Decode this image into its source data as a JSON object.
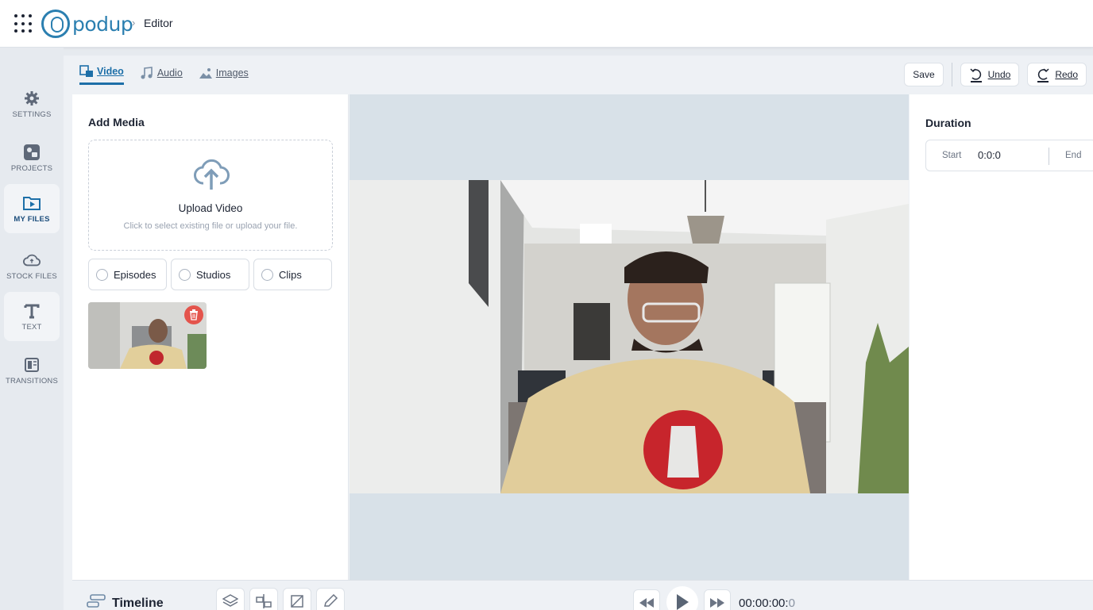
{
  "header": {
    "logo_text": "podup",
    "breadcrumb": "Editor"
  },
  "sidebar": {
    "items": [
      {
        "label": "SETTINGS",
        "icon": "gear-icon"
      },
      {
        "label": "PROJECTS",
        "icon": "projects-icon"
      },
      {
        "label": "MY FILES",
        "icon": "my-files-icon",
        "active": true
      },
      {
        "label": "STOCK FILES",
        "icon": "cloud-icon"
      },
      {
        "label": "TEXT",
        "icon": "text-icon"
      },
      {
        "label": "TRANSITIONS",
        "icon": "transitions-icon"
      }
    ]
  },
  "tabs": [
    {
      "label": "Video",
      "icon": "video-icon",
      "active": true
    },
    {
      "label": "Audio",
      "icon": "music-icon"
    },
    {
      "label": "Images",
      "icon": "image-icon"
    }
  ],
  "toolbar": {
    "save_label": "Save",
    "undo_label": "Undo",
    "redo_label": "Redo"
  },
  "media": {
    "title": "Add Media",
    "upload_title": "Upload Video",
    "upload_subtitle": "Click to select existing file or upload your file.",
    "filters": [
      "Episodes",
      "Studios",
      "Clips"
    ]
  },
  "duration": {
    "title": "Duration",
    "start_label": "Start",
    "start_value": "0:0:0",
    "end_label": "End"
  },
  "timeline": {
    "title": "Timeline",
    "time_main": "00:00:00:",
    "time_frac": "0"
  },
  "colors": {
    "accent": "#1d6fa8",
    "brand": "#2b7fb0",
    "danger": "#e4544c",
    "preview_bg": "#d8e1e8"
  }
}
